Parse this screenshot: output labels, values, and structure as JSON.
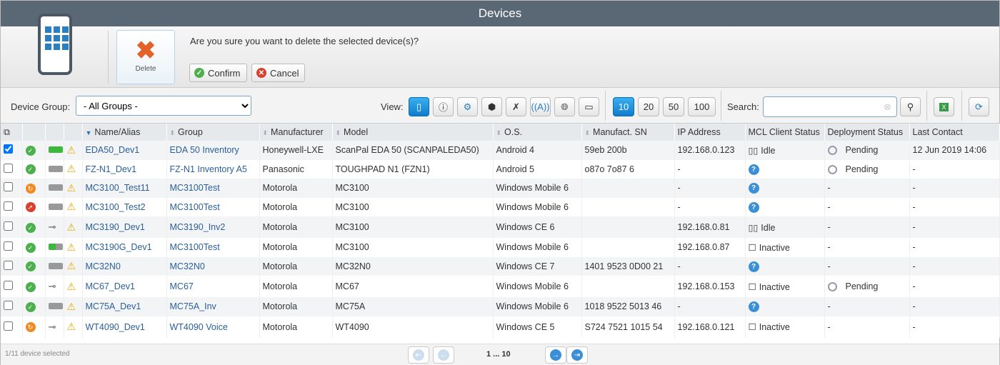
{
  "title": "Devices",
  "dialog": {
    "delete_label": "Delete",
    "message": "Are you sure you want to delete the selected device(s)?",
    "confirm": "Confirm",
    "cancel": "Cancel"
  },
  "toolbar": {
    "group_label": "Device Group:",
    "group_value": "- All Groups -",
    "view_label": "View:",
    "page_sizes": [
      "10",
      "20",
      "50",
      "100"
    ],
    "active_page_size": "10",
    "search_label": "Search:",
    "search_value": ""
  },
  "columns": [
    "Name/Alias",
    "Group",
    "Manufacturer",
    "Model",
    "O.S.",
    "Manufact. SN",
    "IP Address",
    "MCL Client Status",
    "Deployment Status",
    "Last Contact"
  ],
  "rows": [
    {
      "checked": true,
      "status": "ok",
      "battery": "full",
      "name": "EDA50_Dev1",
      "group": "EDA 50 Inventory",
      "mfr": "Honeywell-LXE",
      "model": "ScanPal EDA 50 (SCANPALEDA50)",
      "os": "Android 4",
      "sn": "59eb 200b",
      "ip": "192.168.0.123",
      "mcl": "Idle",
      "mcl_icon": "idle",
      "deploy": "Pending",
      "last": "12 Jun 2019 14:06"
    },
    {
      "checked": false,
      "status": "ok",
      "battery": "empty",
      "name": "FZ-N1_Dev1",
      "group": "FZ-N1 Inventory A5",
      "mfr": "Panasonic",
      "model": "TOUGHPAD N1 (FZN1)",
      "os": "Android 5",
      "sn": "o87o 7o87 6",
      "ip": "-",
      "mcl": "",
      "mcl_icon": "unknown",
      "deploy": "Pending",
      "last": "-"
    },
    {
      "checked": false,
      "status": "warn",
      "battery": "empty",
      "name": "MC3100_Test11",
      "group": "MC3100Test",
      "mfr": "Motorola",
      "model": "MC3100",
      "os": "Windows Mobile 6",
      "sn": "",
      "ip": "-",
      "mcl": "",
      "mcl_icon": "unknown",
      "deploy": "-",
      "last": "-"
    },
    {
      "checked": false,
      "status": "error",
      "battery": "empty",
      "name": "MC3100_Test2",
      "group": "MC3100Test",
      "mfr": "Motorola",
      "model": "MC3100",
      "os": "Windows Mobile 6",
      "sn": "",
      "ip": "-",
      "mcl": "",
      "mcl_icon": "unknown",
      "deploy": "-",
      "last": "-"
    },
    {
      "checked": false,
      "status": "ok",
      "battery": "plug",
      "name": "MC3190_Dev1",
      "group": "MC3190_Inv2",
      "mfr": "Motorola",
      "model": "MC3100",
      "os": "Windows CE 6",
      "sn": "",
      "ip": "192.168.0.81",
      "mcl": "Idle",
      "mcl_icon": "idle",
      "deploy": "-",
      "last": "-"
    },
    {
      "checked": false,
      "status": "ok",
      "battery": "half",
      "name": "MC3190G_Dev1",
      "group": "MC3100Test",
      "mfr": "Motorola",
      "model": "MC3100",
      "os": "Windows Mobile 6",
      "sn": "",
      "ip": "192.168.0.87",
      "mcl": "Inactive",
      "mcl_icon": "inactive",
      "deploy": "-",
      "last": "-"
    },
    {
      "checked": false,
      "status": "ok",
      "battery": "empty",
      "name": "MC32N0",
      "group": "MC32N0",
      "mfr": "Motorola",
      "model": "MC32N0",
      "os": "Windows CE 7",
      "sn": "1401 9523 0D00 21",
      "ip": "-",
      "mcl": "",
      "mcl_icon": "unknown",
      "deploy": "-",
      "last": "-"
    },
    {
      "checked": false,
      "status": "ok",
      "battery": "plug",
      "name": "MC67_Dev1",
      "group": "MC67",
      "mfr": "Motorola",
      "model": "MC67",
      "os": "Windows Mobile 6",
      "sn": "",
      "ip": "192.168.0.153",
      "mcl": "Inactive",
      "mcl_icon": "inactive",
      "deploy": "Pending",
      "last": "-"
    },
    {
      "checked": false,
      "status": "ok",
      "battery": "empty",
      "name": "MC75A_Dev1",
      "group": "MC75A_Inv",
      "mfr": "Motorola",
      "model": "MC75A",
      "os": "Windows Mobile 6",
      "sn": "1018 9522 5013 46",
      "ip": "-",
      "mcl": "",
      "mcl_icon": "unknown",
      "deploy": "-",
      "last": "-"
    },
    {
      "checked": false,
      "status": "warn",
      "battery": "plug",
      "name": "WT4090_Dev1",
      "group": "WT4090 Voice",
      "mfr": "Motorola",
      "model": "WT4090",
      "os": "Windows CE 5",
      "sn": "S724 7521 1015 54",
      "ip": "192.168.0.121",
      "mcl": "Inactive",
      "mcl_icon": "inactive",
      "deploy": "-",
      "last": "-"
    }
  ],
  "footer": {
    "selection": "1/11 device selected",
    "pages": "1 ... 10"
  }
}
